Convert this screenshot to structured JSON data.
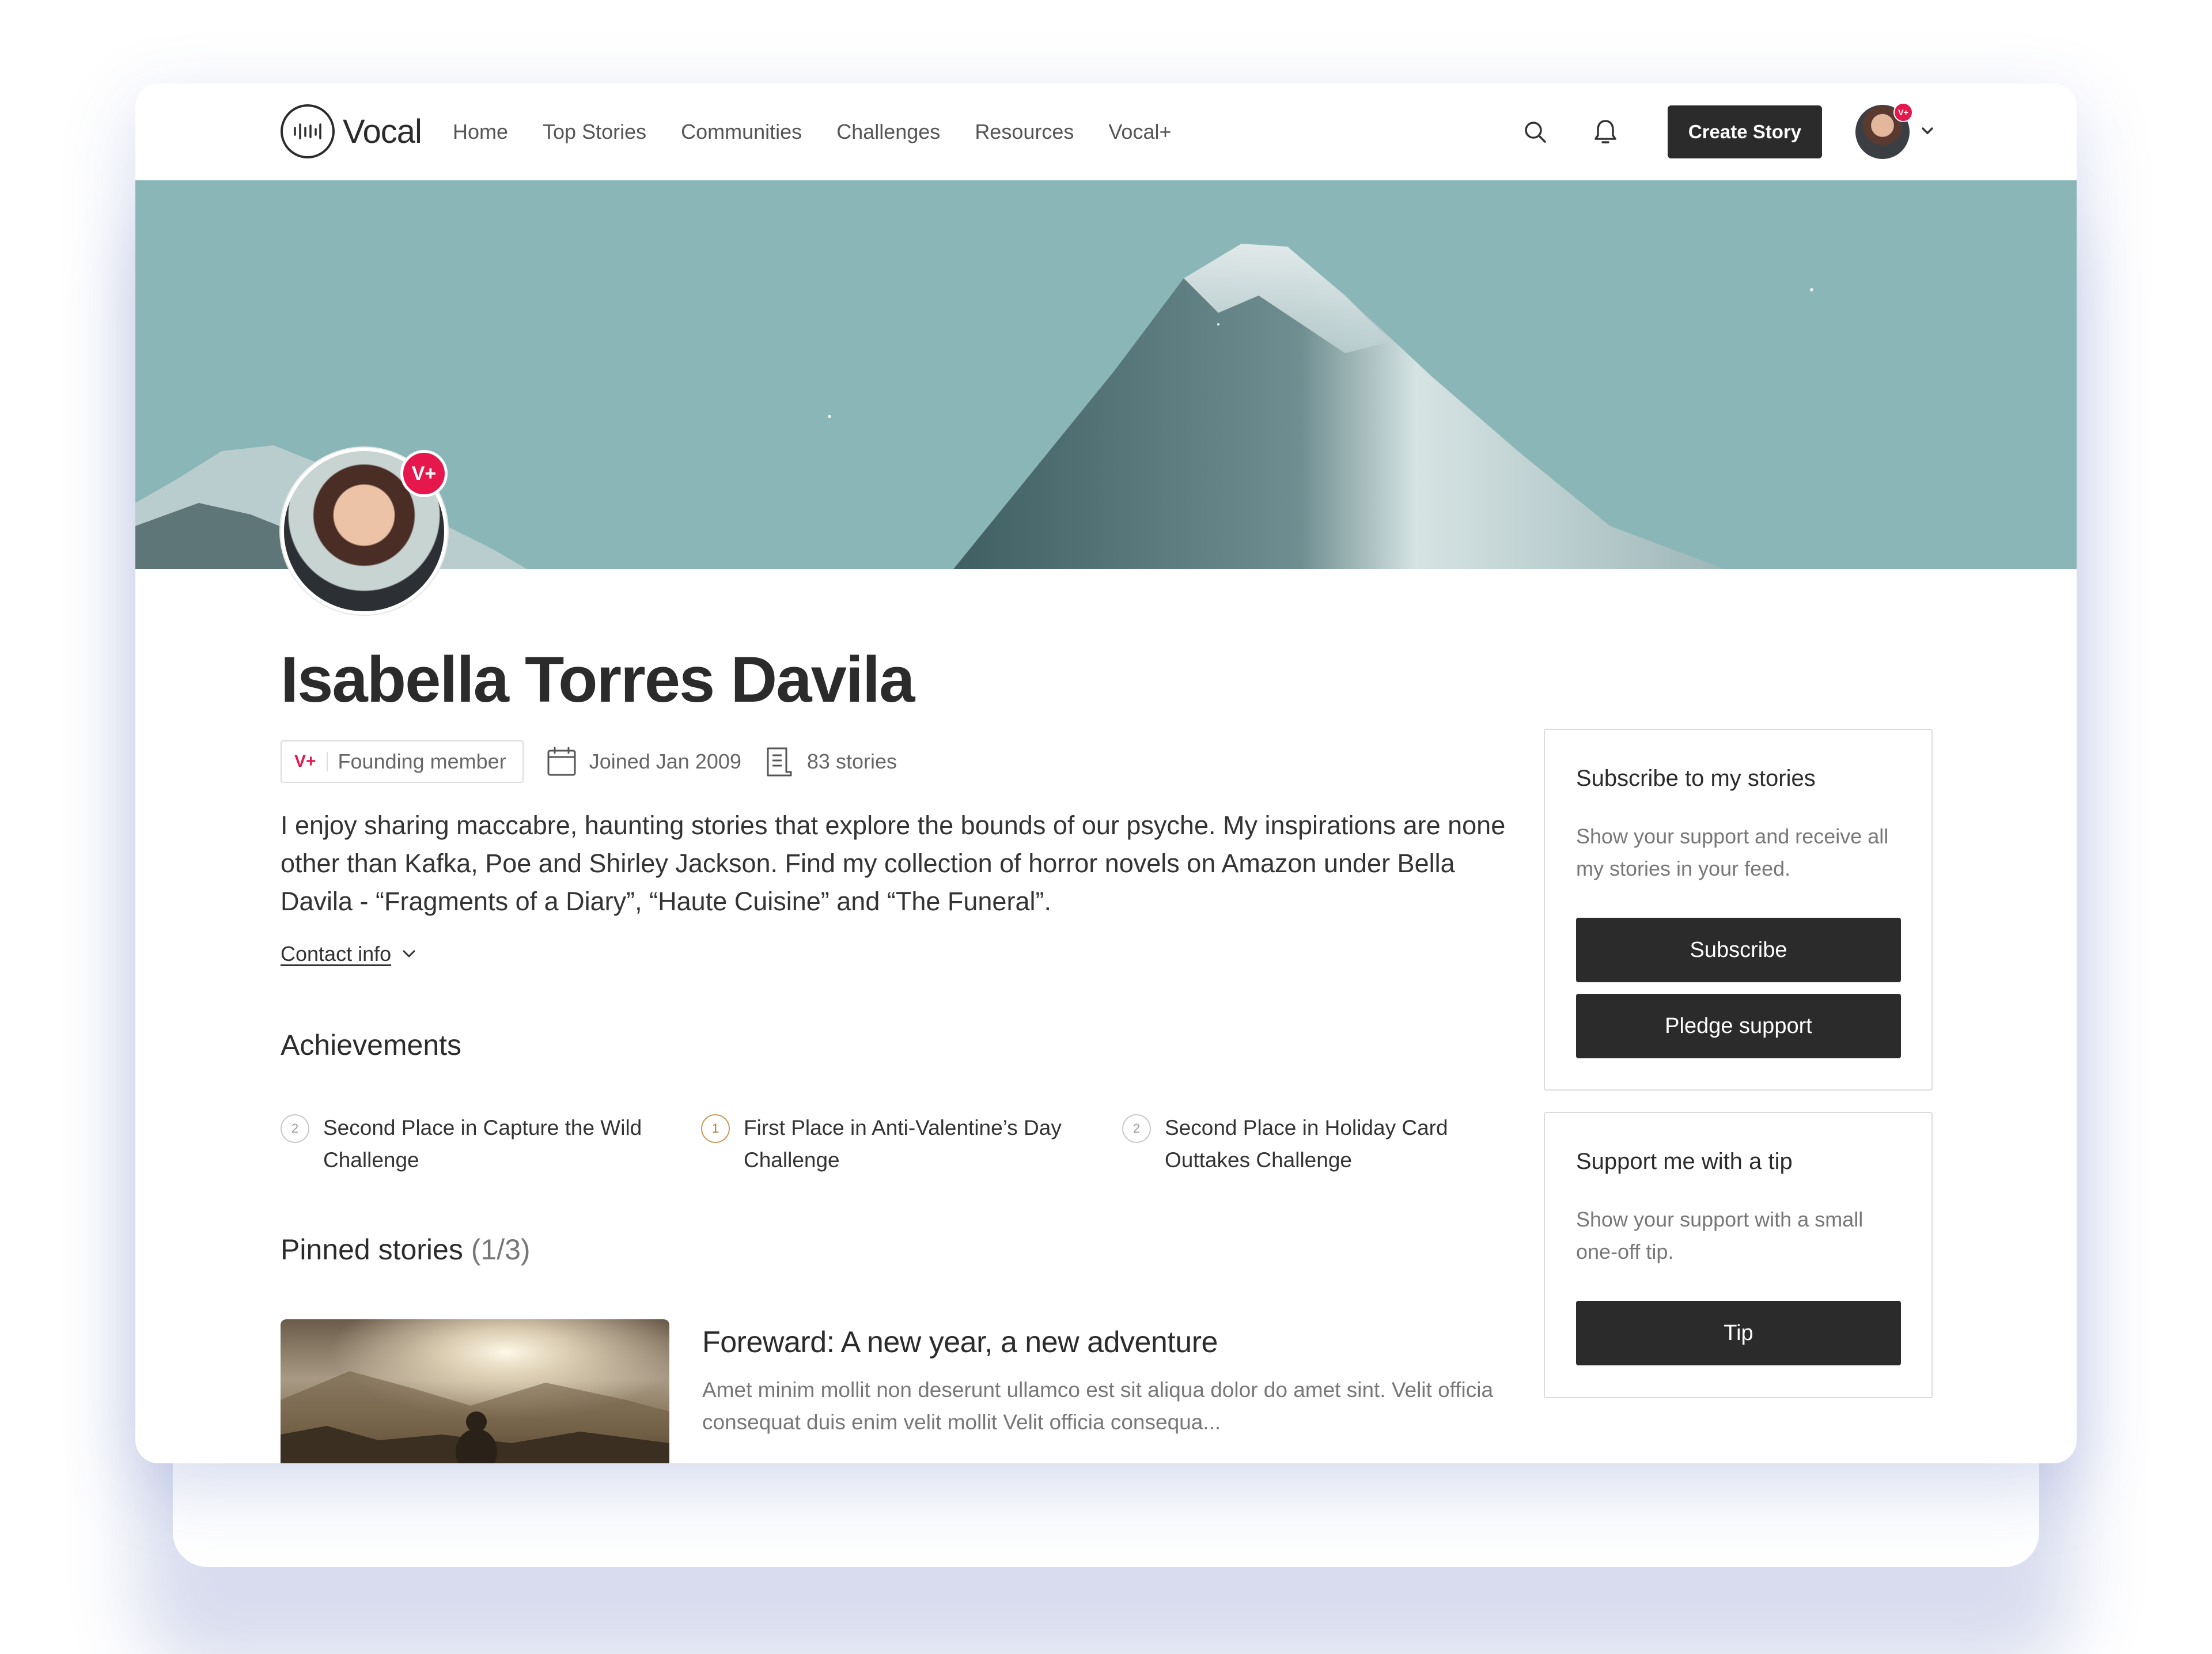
{
  "nav": {
    "logo_text": "Vocal",
    "links": [
      "Home",
      "Top Stories",
      "Communities",
      "Challenges",
      "Resources",
      "Vocal+"
    ],
    "create_label": "Create Story",
    "avatar_badge": "V+"
  },
  "profile": {
    "badge": "V+",
    "name": "Isabella Torres Davila",
    "founding_badge": "V+",
    "founding_label": "Founding member",
    "joined": "Joined Jan 2009",
    "stories_count": "83 stories",
    "bio": "I enjoy sharing maccabre, haunting stories that explore the bounds of our psyche. My inspirations are none other than Kafka, Poe and Shirley Jackson. Find my collection of horror novels on Amazon under Bella Davila - “Fragments of a Diary”, “Haute Cuisine” and “The Funeral”.",
    "contact_label": "Contact info"
  },
  "achievements": {
    "title": "Achievements",
    "items": [
      {
        "place": "2",
        "text": "Second Place in Capture the Wild Challenge"
      },
      {
        "place": "1",
        "text": "First Place in Anti-Valentine’s Day Challenge"
      },
      {
        "place": "2",
        "text": "Second Place in Holiday Card Outtakes Challenge"
      }
    ]
  },
  "pinned": {
    "title": "Pinned stories",
    "count": "(1/3)",
    "story": {
      "title": "Foreward: A new year, a new adventure",
      "excerpt": "Amet minim mollit non deserunt ullamco est sit aliqua dolor do amet sint. Velit officia consequat duis enim velit mollit Velit officia consequa..."
    }
  },
  "subscribe_card": {
    "title": "Subscribe to my stories",
    "text": "Show your support and receive all my stories in your feed.",
    "subscribe_label": "Subscribe",
    "pledge_label": "Pledge support"
  },
  "tip_card": {
    "title": "Support me with a tip",
    "text": "Show your support with a small one-off tip.",
    "tip_label": "Tip"
  },
  "colors": {
    "accent": "#e5174d",
    "dark": "#2b2b2b",
    "banner": "#8ab6b7"
  }
}
